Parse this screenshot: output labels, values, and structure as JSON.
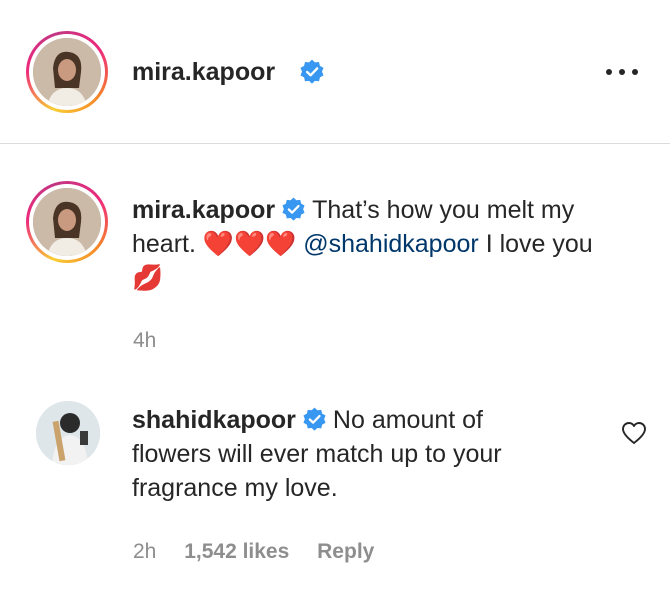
{
  "post_header": {
    "username": "mira.kapoor"
  },
  "caption": {
    "username": "mira.kapoor",
    "text_part1": "That’s how you melt my",
    "text_part2_prefix": "heart.",
    "hearts": "❤️❤️❤️",
    "mention": "@shahidkapoor",
    "text_part2_suffix": "I love you",
    "lips": "💋",
    "time": "4h"
  },
  "reply": {
    "username": "shahidkapoor",
    "text_line1": "No amount of",
    "text_line2": "flowers will ever match up to your",
    "text_line3": "fragrance my love.",
    "time": "2h",
    "likes": "1,542 likes",
    "reply_label": "Reply"
  },
  "colors": {
    "verified_badge": "#3897f0",
    "mention": "#00376b",
    "meta_gray": "#8e8e8e"
  }
}
